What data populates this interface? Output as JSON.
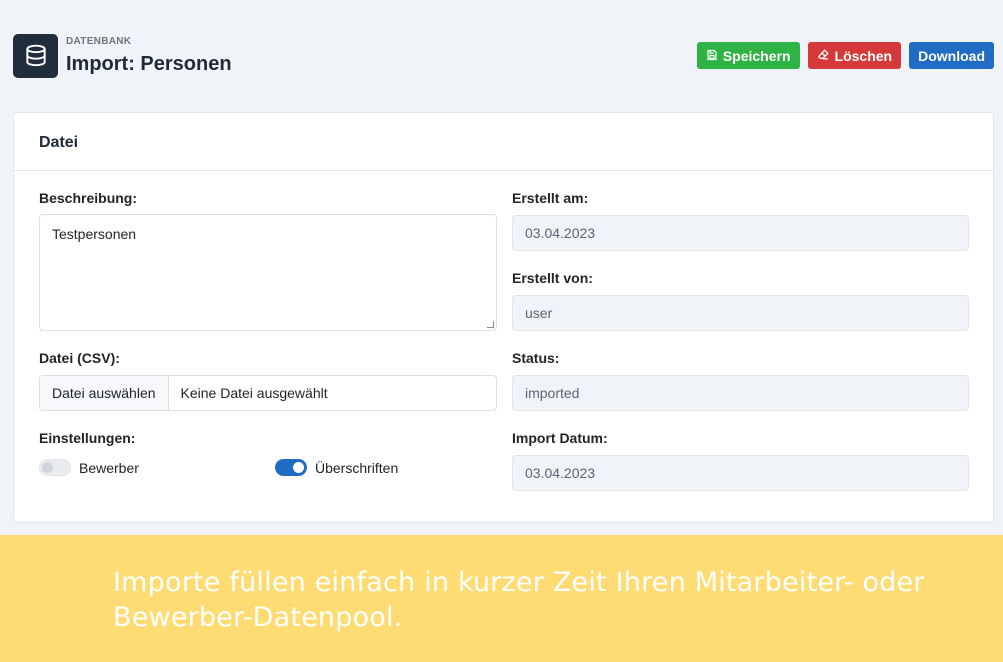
{
  "header": {
    "icon": "database-icon",
    "pretitle": "DATENBANK",
    "title": "Import: Personen"
  },
  "actions": {
    "save_label": "Speichern",
    "delete_label": "Löschen",
    "download_label": "Download"
  },
  "colors": {
    "save": "#2fb344",
    "delete": "#d63939",
    "download": "#206bc4",
    "banner": "#ffdc73"
  },
  "card": {
    "title": "Datei",
    "description": {
      "label": "Beschreibung:",
      "value": "Testpersonen"
    },
    "file": {
      "label": "Datei (CSV):",
      "button_label": "Datei auswählen",
      "file_name": "Keine Datei ausgewählt"
    },
    "settings": {
      "label": "Einstellungen:",
      "toggles": [
        {
          "label": "Bewerber",
          "checked": false
        },
        {
          "label": "Überschriften",
          "checked": true
        }
      ]
    },
    "created_at": {
      "label": "Erstellt am:",
      "value": "03.04.2023"
    },
    "created_by": {
      "label": "Erstellt von:",
      "value": "user"
    },
    "status": {
      "label": "Status:",
      "value": "imported"
    },
    "import_date": {
      "label": "Import Datum:",
      "value": "03.04.2023"
    }
  },
  "banner": {
    "text": "Importe füllen einfach in kurzer Zeit Ihren Mitarbeiter- oder Bewerber-Datenpool."
  }
}
